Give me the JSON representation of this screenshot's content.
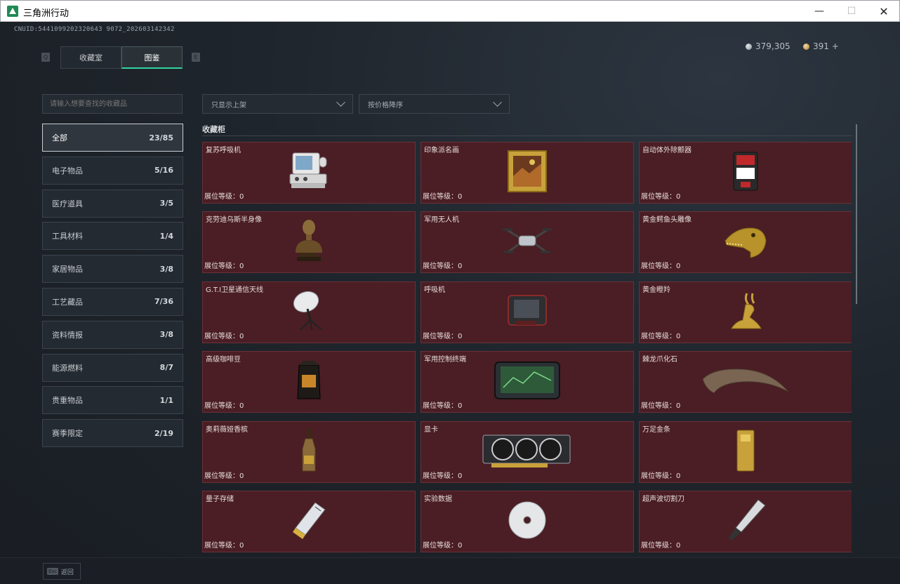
{
  "window": {
    "title": "三角洲行动",
    "min": "—",
    "max": "☐",
    "close": "✕"
  },
  "uid": "CNUID:5441099202320643 9072_202603142342",
  "currency": {
    "silver": "379,305",
    "gold": "391 +"
  },
  "hotkeys": {
    "prev": "Q",
    "next": "E"
  },
  "tabs": [
    {
      "label": "收藏室"
    },
    {
      "label": "图鉴"
    }
  ],
  "search": {
    "placeholder": "请输入想要查找的收藏品"
  },
  "filters": {
    "shelf": "只显示上架",
    "sort": "按价格降序"
  },
  "section": {
    "title": "收藏柜"
  },
  "categories": [
    {
      "label": "全部",
      "count": "23/85"
    },
    {
      "label": "电子物品",
      "count": "5/16"
    },
    {
      "label": "医疗道具",
      "count": "3/5"
    },
    {
      "label": "工具材料",
      "count": "1/4"
    },
    {
      "label": "家居物品",
      "count": "3/8"
    },
    {
      "label": "工艺藏品",
      "count": "7/36"
    },
    {
      "label": "资料情报",
      "count": "3/8"
    },
    {
      "label": "能源燃料",
      "count": "8/7"
    },
    {
      "label": "贵重物品",
      "count": "1/1"
    },
    {
      "label": "赛季限定",
      "count": "2/19"
    }
  ],
  "items": [
    {
      "name": "复苏呼吸机",
      "level": "展位等级：0",
      "icon": "respirator-icon"
    },
    {
      "name": "印象派名画",
      "level": "展位等级：0",
      "icon": "painting-icon"
    },
    {
      "name": "自动体外除颤器",
      "level": "展位等级：0",
      "icon": "defibrillator-icon"
    },
    {
      "name": "克劳迪乌斯半身像",
      "level": "展位等级：0",
      "icon": "bust-icon"
    },
    {
      "name": "军用无人机",
      "level": "展位等级：0",
      "icon": "drone-icon"
    },
    {
      "name": "黄金鳄鱼头雕像",
      "level": "展位等级：0",
      "icon": "crocodile-head-icon"
    },
    {
      "name": "G.T.I卫星通信天线",
      "level": "展位等级：0",
      "icon": "satellite-dish-icon"
    },
    {
      "name": "呼吸机",
      "level": "展位等级：0",
      "icon": "ventilator-icon"
    },
    {
      "name": "黄金瞪羚",
      "level": "展位等级：0",
      "icon": "gazelle-icon"
    },
    {
      "name": "高级咖啡豆",
      "level": "展位等级：0",
      "icon": "coffee-bag-icon"
    },
    {
      "name": "军用控制终端",
      "level": "展位等级：0",
      "icon": "terminal-icon"
    },
    {
      "name": "棘龙爪化石",
      "level": "展位等级：0",
      "icon": "claw-fossil-icon"
    },
    {
      "name": "奥莉薇娅香槟",
      "level": "展位等级：0",
      "icon": "champagne-icon"
    },
    {
      "name": "显卡",
      "level": "展位等级：0",
      "icon": "gpu-icon"
    },
    {
      "name": "万足金条",
      "level": "展位等级：0",
      "icon": "gold-bar-icon"
    },
    {
      "name": "量子存储",
      "level": "展位等级：0",
      "icon": "quantum-storage-icon"
    },
    {
      "name": "实验数据",
      "level": "展位等级：0",
      "icon": "disc-icon"
    },
    {
      "name": "超声波切割刀",
      "level": "展位等级：0",
      "icon": "ultrasonic-knife-icon"
    }
  ],
  "footer": {
    "key": "Esc",
    "label": "返回"
  },
  "colors": {
    "accent": "#2fd4a0",
    "card": "#4a1e24",
    "background": "#1e232a"
  }
}
